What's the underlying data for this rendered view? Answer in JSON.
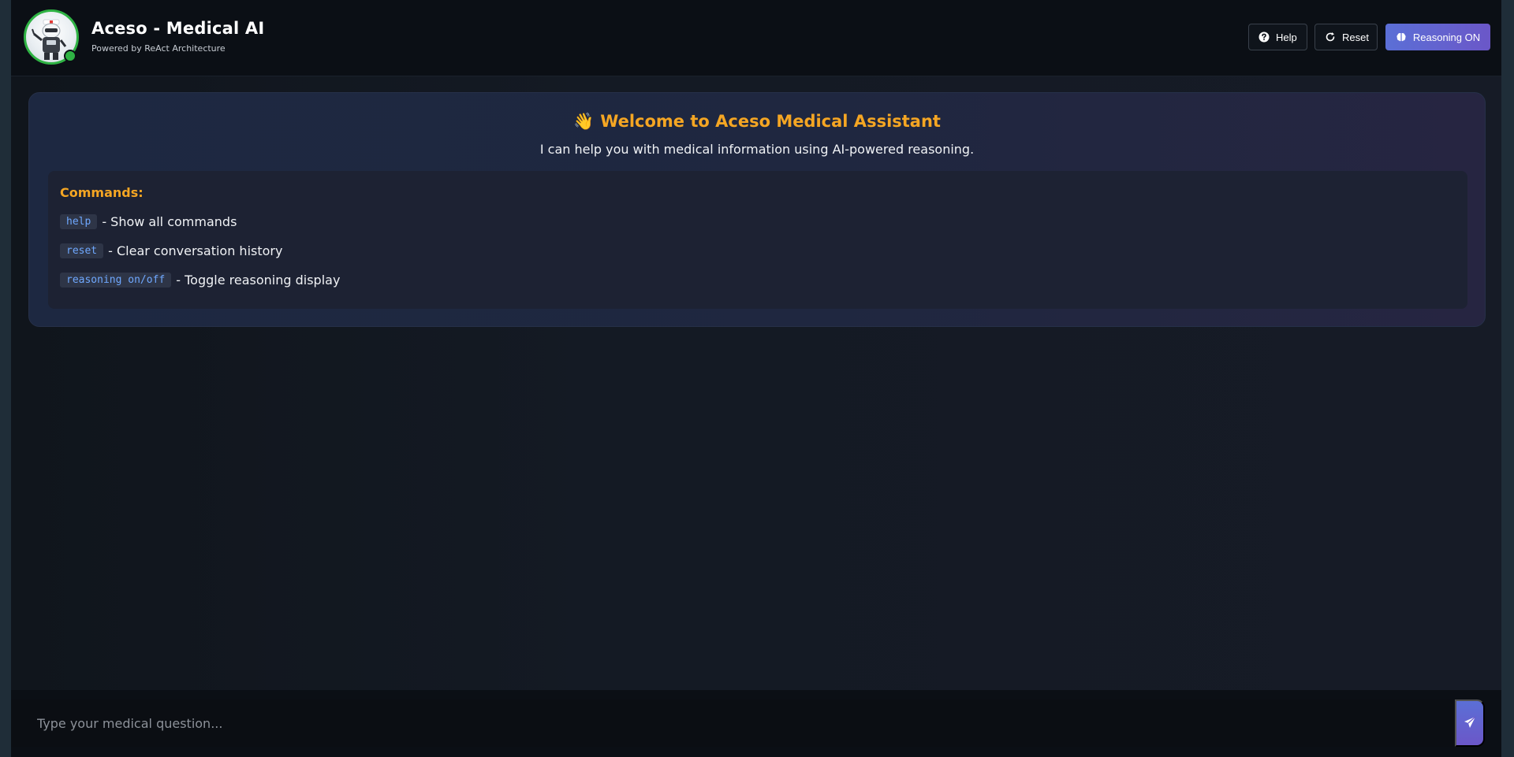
{
  "header": {
    "app_title": "Aceso - Medical AI",
    "app_subtitle": "Powered by ReAct Architecture",
    "buttons": {
      "help": "Help",
      "reset": "Reset",
      "reasoning": "Reasoning ON"
    },
    "avatar_icon": "robot-nurse-icon",
    "online_status_color": "#2fb344"
  },
  "welcome": {
    "emoji": "👋",
    "title": "Welcome to Aceso Medical Assistant",
    "subtitle": "I can help you with medical information using AI-powered reasoning.",
    "commands_title": "Commands:",
    "commands": [
      {
        "code": "help",
        "description": "- Show all commands"
      },
      {
        "code": "reset",
        "description": "- Clear conversation history"
      },
      {
        "code": "reasoning on/off",
        "description": "- Toggle reasoning display"
      }
    ]
  },
  "input": {
    "placeholder": "Type your medical question...",
    "value": "",
    "send_icon": "paper-plane-icon"
  },
  "colors": {
    "accent": "#f5a623",
    "primary_gradient_start": "#5b6fd6",
    "primary_gradient_end": "#6b57c8",
    "code_text": "#6fa8ff"
  }
}
